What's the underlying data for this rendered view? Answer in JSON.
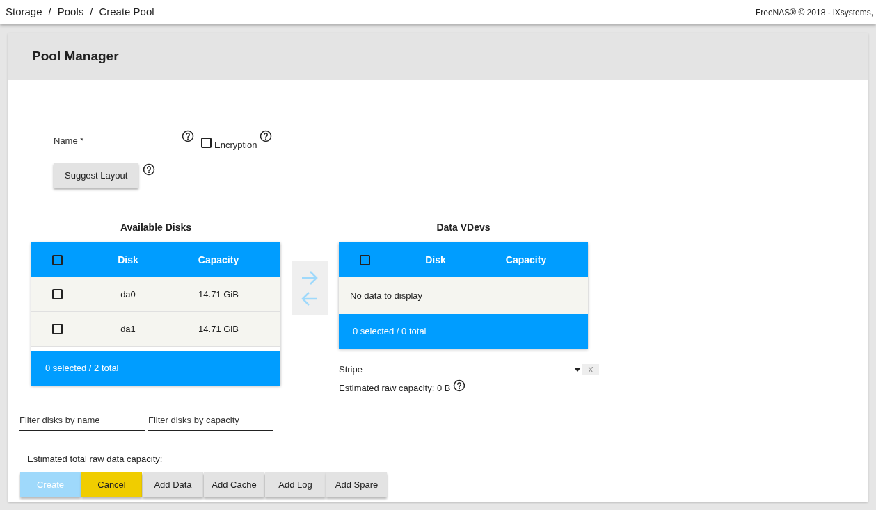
{
  "breadcrumb": [
    "Storage",
    "Pools",
    "Create Pool"
  ],
  "breadcrumb_separator": "/",
  "copyright": "FreeNAS® © 2018 - iXsystems,",
  "card": {
    "title": "Pool Manager"
  },
  "name_field": {
    "placeholder": "Name *"
  },
  "encryption": {
    "label": "Encryption",
    "checked": false
  },
  "suggest_button": "Suggest Layout",
  "available": {
    "title": "Available Disks",
    "all_checked": false,
    "columns": [
      "Disk",
      "Capacity"
    ],
    "rows": [
      {
        "checked": false,
        "disk": "da0",
        "capacity": "14.71 GiB"
      },
      {
        "checked": false,
        "disk": "da1",
        "capacity": "14.71 GiB"
      }
    ],
    "footer": "0 selected / 2 total"
  },
  "vdevs": {
    "title": "Data VDevs",
    "all_checked": false,
    "columns": [
      "Disk",
      "Capacity"
    ],
    "empty": "No data to display",
    "footer": "0 selected / 0 total",
    "layout": "Stripe",
    "remove": "X",
    "estimate": "Estimated raw capacity: 0 B"
  },
  "filters": [
    {
      "placeholder": "Filter disks by name"
    },
    {
      "placeholder": "Filter disks by capacity"
    }
  ],
  "total_estimate": "Estimated total raw data capacity:",
  "buttons": [
    {
      "label": "Create",
      "kind": "primary",
      "disabled": true
    },
    {
      "label": "Cancel",
      "kind": "accent",
      "disabled": false
    },
    {
      "label": "Add Data",
      "kind": "plain",
      "disabled": false
    },
    {
      "label": "Add Cache",
      "kind": "plain",
      "disabled": false
    },
    {
      "label": "Add Log",
      "kind": "plain",
      "disabled": false
    },
    {
      "label": "Add Spare",
      "kind": "plain",
      "disabled": false
    }
  ]
}
